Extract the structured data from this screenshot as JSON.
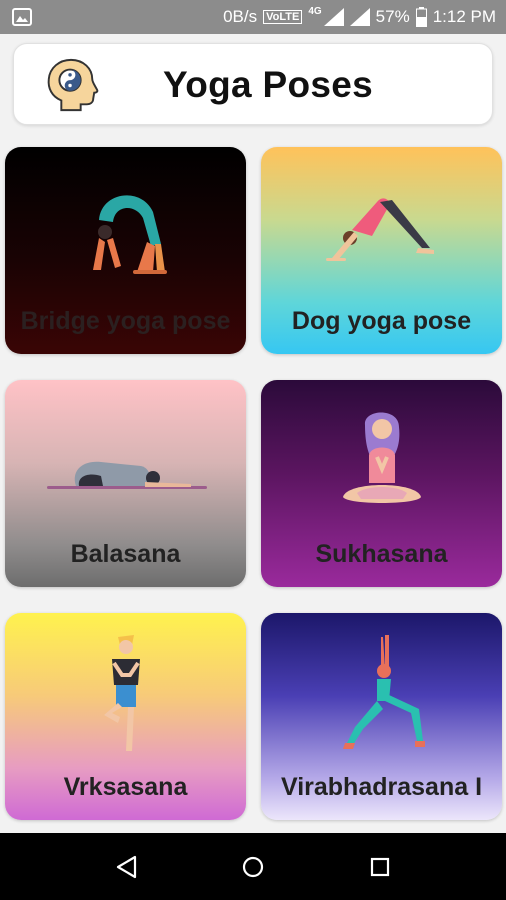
{
  "status_bar": {
    "net_speed": "0B/s",
    "volte": "VoLTE",
    "network_type": "4G",
    "battery": "57%",
    "time": "1:12 PM"
  },
  "header": {
    "title": "Yoga Poses",
    "logo_icon": "mind-yinyang-head-icon"
  },
  "poses": [
    {
      "label": "Bridge yoga pose",
      "icon": "bridge-pose-figure"
    },
    {
      "label": "Dog yoga pose",
      "icon": "downward-dog-figure"
    },
    {
      "label": "Balasana",
      "icon": "child-pose-figure"
    },
    {
      "label": "Sukhasana",
      "icon": "easy-pose-meditation-figure"
    },
    {
      "label": "Vrksasana",
      "icon": "tree-pose-figure"
    },
    {
      "label": "Virabhadrasana I",
      "icon": "warrior-pose-figure"
    }
  ],
  "nav": {
    "back": "back-icon",
    "home": "home-icon",
    "recents": "recents-icon"
  }
}
